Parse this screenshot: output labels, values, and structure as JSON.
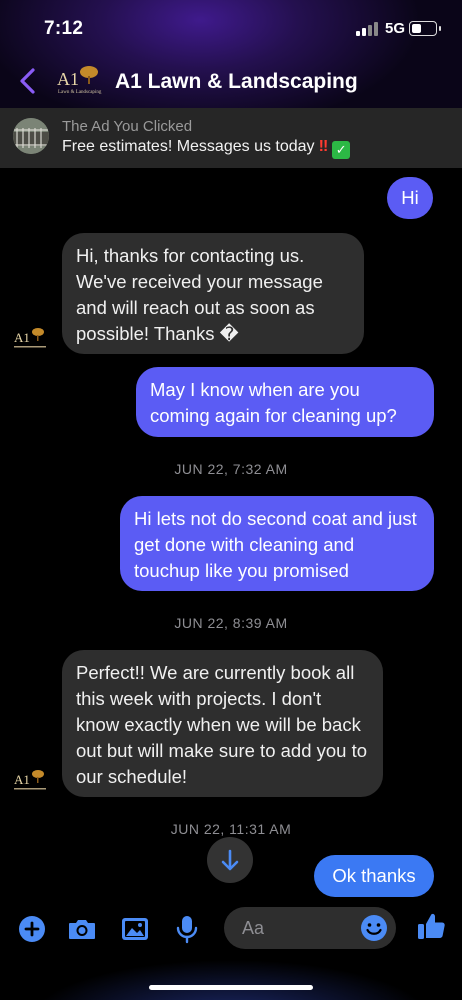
{
  "status_bar": {
    "time": "7:12",
    "network": "5G"
  },
  "header": {
    "title": "A1 Lawn & Landscaping",
    "logo_text": "A1",
    "logo_subtext": "Lawn & Landscaping"
  },
  "ad": {
    "label": "The Ad You Clicked",
    "text": "Free estimates! Messages us today",
    "emoji_bang": "‼",
    "emoji_check": "✓"
  },
  "messages": [
    {
      "from": "me",
      "text": "Hi"
    },
    {
      "from": "them",
      "text": "Hi, thanks for contacting us. We've received your message and will reach out as soon as possible! Thanks �"
    },
    {
      "from": "me",
      "text": "May I know when are you coming again for cleaning up?"
    },
    {
      "from": "timestamp",
      "text": "JUN 22, 7:32 AM"
    },
    {
      "from": "me",
      "text": "Hi lets not do second coat and just get done with cleaning and touchup like you promised"
    },
    {
      "from": "timestamp",
      "text": "JUN 22, 8:39 AM"
    },
    {
      "from": "them",
      "text": "Perfect!! We are currently book all this week with projects. I don't know exactly when we will be back out but will make sure to add you to our schedule!"
    },
    {
      "from": "timestamp",
      "text": "JUN 22, 11:31 AM"
    },
    {
      "from": "me",
      "text": "Ok thanks"
    }
  ],
  "composer": {
    "placeholder": "Aa"
  },
  "colors": {
    "outgoing": "#5b5cf4",
    "outgoing_last": "#3b79f3",
    "incoming": "#2e2e2e",
    "accent": "#4b8bf5",
    "header_accent": "#8a5cf6"
  },
  "icons": [
    "chevron-left-icon",
    "plus-icon",
    "camera-icon",
    "image-icon",
    "microphone-icon",
    "smiley-icon",
    "thumbs-up-icon",
    "arrow-down-icon"
  ]
}
